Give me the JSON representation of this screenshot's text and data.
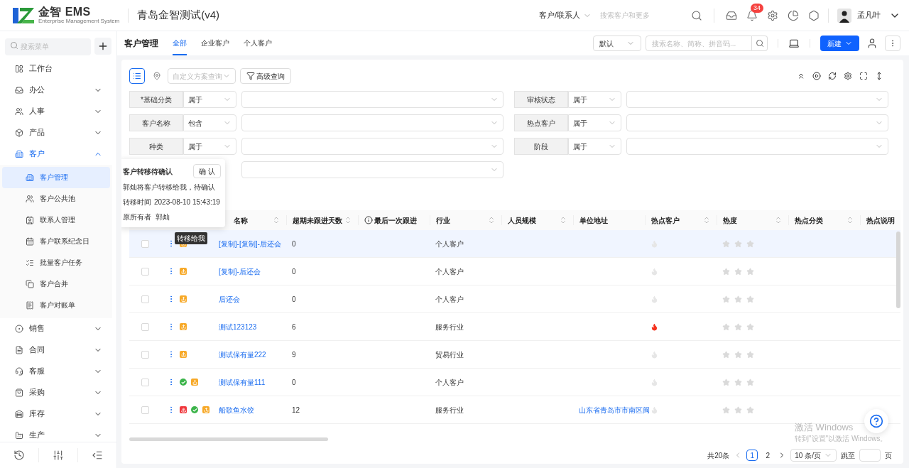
{
  "header": {
    "brand": "金智 EMS",
    "brand_sub": "Enterprise Management System",
    "company": "青岛金智测试(v4)",
    "search_scope": "客户/联系人",
    "search_placeholder": "搜索客户和更多",
    "notifications": "34",
    "user": "孟凡叶"
  },
  "sidebar": {
    "search_placeholder": "搜索菜单",
    "items": [
      {
        "label": "工作台",
        "kind": "link"
      },
      {
        "label": "办公",
        "kind": "group",
        "expanded": false
      },
      {
        "label": "人事",
        "kind": "group",
        "expanded": false
      },
      {
        "label": "产品",
        "kind": "group",
        "expanded": false
      },
      {
        "label": "客户",
        "kind": "group",
        "expanded": true,
        "children": [
          {
            "label": "客户管理",
            "selected": true
          },
          {
            "label": "客户公共池",
            "selected": false
          },
          {
            "label": "联系人管理",
            "selected": false
          },
          {
            "label": "客户联系纪念日",
            "selected": false
          },
          {
            "label": "批量客户任务",
            "selected": false
          },
          {
            "label": "客户合并",
            "selected": false
          },
          {
            "label": "客户对账单",
            "selected": false
          }
        ]
      },
      {
        "label": "销售",
        "kind": "group",
        "expanded": false
      },
      {
        "label": "合同",
        "kind": "group",
        "expanded": false
      },
      {
        "label": "客服",
        "kind": "group",
        "expanded": false
      },
      {
        "label": "采购",
        "kind": "group",
        "expanded": false
      },
      {
        "label": "库存",
        "kind": "group",
        "expanded": false
      },
      {
        "label": "生产",
        "kind": "group",
        "expanded": false
      }
    ]
  },
  "page": {
    "title": "客户管理",
    "tabs": [
      {
        "label": "全部",
        "selected": true
      },
      {
        "label": "企业客户",
        "selected": false
      },
      {
        "label": "个人客户",
        "selected": false
      }
    ],
    "view_select": "默认",
    "search_placeholder": "搜索名称、简称、拼音码...",
    "new_button": "新建"
  },
  "toolbar": {
    "scheme_placeholder": "自定义方案查询",
    "advanced_query": "高级查询"
  },
  "filters": [
    {
      "kind": "full",
      "label": "*基础分类",
      "operator": "属于"
    },
    {
      "kind": "full",
      "label": "审核状态",
      "operator": "属于"
    },
    {
      "kind": "full",
      "label": "客户名称",
      "operator": "包含"
    },
    {
      "kind": "full",
      "label": "热点客户",
      "operator": "属于"
    },
    {
      "kind": "full",
      "label": "种类",
      "operator": "属于"
    },
    {
      "kind": "full",
      "label": "阶段",
      "operator": "属于"
    },
    {
      "kind": "value"
    }
  ],
  "popover": {
    "title": "客户转移待确认",
    "confirm": "确 认",
    "message": "郭灿将客户转移给我，待确认",
    "time_label": "转移时间",
    "time": "2023-08-10 15:43:19",
    "owner_label": "原所有者",
    "owner": "郭灿"
  },
  "tooltip": "转移给我",
  "table": {
    "columns": [
      {
        "label": "名称",
        "sortable": true,
        "info": false
      },
      {
        "label": "超期未跟进天数",
        "sortable": true,
        "info": false
      },
      {
        "label": "最后一次跟进",
        "sortable": false,
        "info": true
      },
      {
        "label": "行业",
        "sortable": true,
        "info": false
      },
      {
        "label": "人员规模",
        "sortable": true,
        "info": false
      },
      {
        "label": "单位地址",
        "sortable": false,
        "info": false
      },
      {
        "label": "热点客户",
        "sortable": true,
        "info": false
      },
      {
        "label": "热度",
        "sortable": true,
        "info": false
      },
      {
        "label": "热点分类",
        "sortable": true,
        "info": false
      },
      {
        "label": "热点说明",
        "info": false
      }
    ],
    "rows": [
      {
        "selected": true,
        "checked": false,
        "flags": [
          {
            "kind": "transfer"
          }
        ],
        "name": "[复制]-[复制]-后还会",
        "overdue": "0",
        "industry": "个人客户",
        "hot": false,
        "stars": 0
      },
      {
        "selected": false,
        "checked": false,
        "flags": [
          {
            "kind": "transfer"
          }
        ],
        "name": "[复制]-后还会",
        "overdue": "0",
        "industry": "个人客户",
        "hot": false,
        "stars": 0
      },
      {
        "selected": false,
        "checked": false,
        "flags": [
          {
            "kind": "transfer"
          }
        ],
        "name": "后还会",
        "overdue": "0",
        "industry": "个人客户",
        "hot": false,
        "stars": 0
      },
      {
        "selected": false,
        "checked": false,
        "flags": [
          {
            "kind": "transfer"
          }
        ],
        "name": "测试123123",
        "overdue": "6",
        "industry": "服务行业",
        "hot": true,
        "stars": 0
      },
      {
        "selected": false,
        "checked": false,
        "flags": [
          {
            "kind": "transfer"
          }
        ],
        "name": "测试保有量222",
        "overdue": "9",
        "industry": "贸易行业",
        "hot": false,
        "stars": 0
      },
      {
        "selected": false,
        "checked": false,
        "flags": [
          {
            "kind": "check"
          },
          {
            "kind": "transfer"
          }
        ],
        "name": "测试保有量111",
        "overdue": "0",
        "industry": "个人客户",
        "hot": false,
        "stars": 0
      },
      {
        "selected": false,
        "checked": false,
        "flags": [
          {
            "kind": "warning"
          },
          {
            "kind": "check"
          },
          {
            "kind": "transfer"
          }
        ],
        "name": "船歌鱼水饺",
        "overdue": "12",
        "industry": "服务行业",
        "address": "山东省青岛市市南区闽",
        "hot": false,
        "stars": 0
      }
    ]
  },
  "pagination": {
    "total": "共20条",
    "pages": [
      {
        "label": "1",
        "selected": true
      },
      {
        "label": "2",
        "selected": false
      }
    ],
    "page_size": "10 条/页",
    "jump_label": "跳至",
    "page_unit": "页"
  },
  "os_notice": {
    "title": "激活 Windows",
    "text": "转到\"设置\"以激活 Windows。"
  }
}
